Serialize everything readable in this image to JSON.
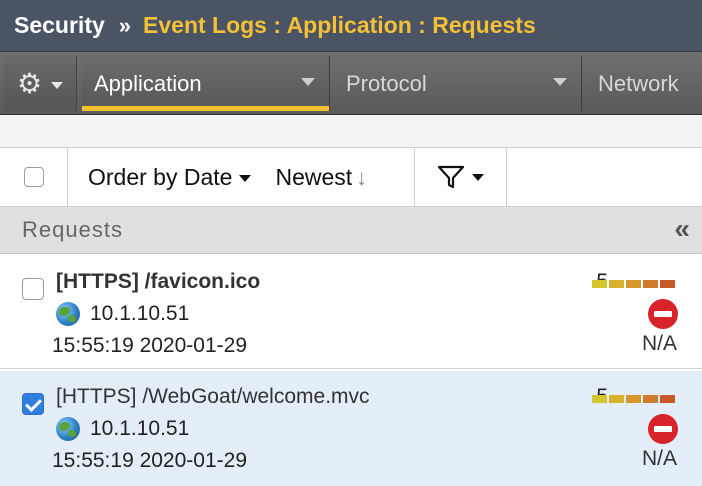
{
  "header": {
    "section": "Security",
    "separator": "»",
    "breadcrumb": "Event Logs : Application : Requests"
  },
  "tabs": [
    {
      "label": "Application",
      "active": true
    },
    {
      "label": "Protocol",
      "active": false
    },
    {
      "label": "Network",
      "active": false
    }
  ],
  "toolbar": {
    "order_label": "Order by Date",
    "sort_label": "Newest",
    "sort_arrow": "↓"
  },
  "list": {
    "title": "Requests",
    "collapse_glyph": "«",
    "rows": [
      {
        "request": "[HTTPS] /favicon.ico",
        "ip": "10.1.10.51",
        "time": "15:55:19 2020-01-29",
        "score": "5",
        "response": "N/A",
        "checked": false
      },
      {
        "request": "[HTTPS] /WebGoat/welcome.mvc",
        "ip": "10.1.10.51",
        "time": "15:55:19 2020-01-29",
        "score": "5",
        "response": "N/A",
        "checked": true
      }
    ]
  },
  "colors": {
    "header_bg": "#4a5465",
    "breadcrumb": "#f4c035",
    "active_tab_underline": "#f2bf2f",
    "selected_row_bg": "#e4eef8",
    "blocked_icon": "#d8232a",
    "severity_levels": [
      "#d4c62e",
      "#d9b12f",
      "#d6952d",
      "#d27a2c",
      "#c85a2a"
    ]
  },
  "icons": {
    "gear": "gear-icon",
    "filter": "filter-icon",
    "globe": "globe-icon",
    "blocked": "blocked-icon",
    "collapse": "double-chevron-left-icon"
  }
}
